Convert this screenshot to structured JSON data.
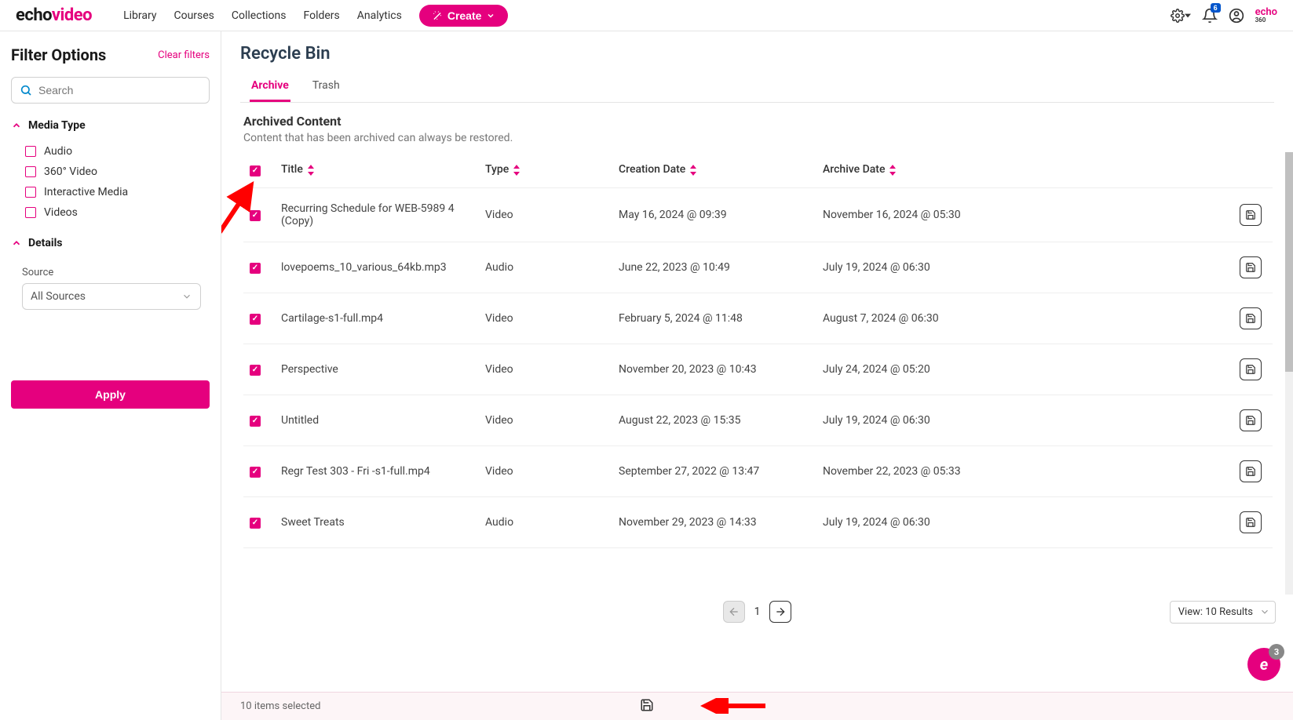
{
  "logo": {
    "part1": "echo",
    "part2": "video"
  },
  "nav": {
    "library": "Library",
    "courses": "Courses",
    "collections": "Collections",
    "folders": "Folders",
    "analytics": "Analytics"
  },
  "create_btn": "Create",
  "notif_badge": "6",
  "echo360": {
    "top": "echo",
    "bottom": "360"
  },
  "sidebar": {
    "title": "Filter Options",
    "clear": "Clear filters",
    "search_placeholder": "Search",
    "media_type": "Media Type",
    "mt_items": [
      "Audio",
      "360° Video",
      "Interactive Media",
      "Videos"
    ],
    "details": "Details",
    "source_label": "Source",
    "source_value": "All Sources",
    "apply": "Apply"
  },
  "page": {
    "title": "Recycle Bin",
    "tabs": [
      "Archive",
      "Trash"
    ],
    "subhead": "Archived Content",
    "subtext": "Content that has been archived can always be restored."
  },
  "columns": {
    "title": "Title",
    "type": "Type",
    "created": "Creation Date",
    "archived": "Archive Date"
  },
  "rows": [
    {
      "title": "Recurring Schedule for WEB-5989 4 (Copy)",
      "type": "Video",
      "created": "May 16, 2024 @ 09:39",
      "archived": "November 16, 2024 @ 05:30"
    },
    {
      "title": "lovepoems_10_various_64kb.mp3",
      "type": "Audio",
      "created": "June 22, 2023 @ 10:49",
      "archived": "July 19, 2024 @ 06:30"
    },
    {
      "title": "Cartilage-s1-full.mp4",
      "type": "Video",
      "created": "February 5, 2024 @ 11:48",
      "archived": "August 7, 2024 @ 06:30"
    },
    {
      "title": "Perspective",
      "type": "Video",
      "created": "November 20, 2023 @ 10:43",
      "archived": "July 24, 2024 @ 05:20"
    },
    {
      "title": "Untitled",
      "type": "Video",
      "created": "August 22, 2023 @ 15:35",
      "archived": "July 19, 2024 @ 06:30"
    },
    {
      "title": "Regr Test 303 - Fri -s1-full.mp4",
      "type": "Video",
      "created": "September 27, 2022 @ 13:47",
      "archived": "November 22, 2023 @ 05:33"
    },
    {
      "title": "Sweet Treats",
      "type": "Audio",
      "created": "November 29, 2023 @ 14:33",
      "archived": "July 19, 2024 @ 06:30"
    }
  ],
  "pager": {
    "page": "1",
    "view": "View: 10 Results"
  },
  "footer": {
    "selected": "10 items selected"
  },
  "help_badge": "3"
}
